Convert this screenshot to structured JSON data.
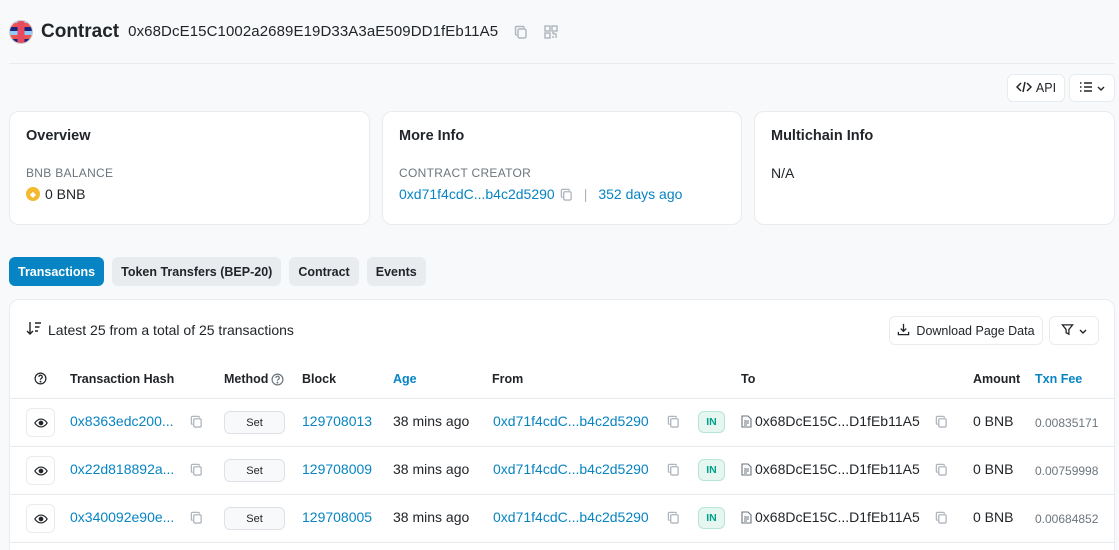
{
  "header": {
    "title": "Contract",
    "address": "0x68DcE15C1002a2689E19D33A3aE509DD1fEb11A5"
  },
  "toolbar": {
    "api_label": "API"
  },
  "overview": {
    "title": "Overview",
    "balance_label": "BNB BALANCE",
    "balance_value": "0 BNB"
  },
  "more_info": {
    "title": "More Info",
    "creator_label": "CONTRACT CREATOR",
    "creator_address": "0xd71f4cdC...b4c2d5290",
    "creator_age": "352 days ago"
  },
  "multichain": {
    "title": "Multichain Info",
    "value": "N/A"
  },
  "tabs": [
    {
      "label": "Transactions",
      "active": true
    },
    {
      "label": "Token Transfers (BEP-20)",
      "active": false
    },
    {
      "label": "Contract",
      "active": false
    },
    {
      "label": "Events",
      "active": false
    }
  ],
  "transactions": {
    "summary": "Latest 25 from a total of 25 transactions",
    "download_label": "Download Page Data",
    "columns": {
      "hash": "Transaction Hash",
      "method": "Method",
      "block": "Block",
      "age": "Age",
      "from": "From",
      "to": "To",
      "amount": "Amount",
      "fee": "Txn Fee"
    },
    "rows": [
      {
        "hash": "0x8363edc200...",
        "method": "Set",
        "block": "129708013",
        "age": "38 mins ago",
        "from": "0xd71f4cdC...b4c2d5290",
        "direction": "IN",
        "to": "0x68DcE15C...D1fEb11A5",
        "amount": "0 BNB",
        "fee": "0.00835171"
      },
      {
        "hash": "0x22d818892a...",
        "method": "Set",
        "block": "129708009",
        "age": "38 mins ago",
        "from": "0xd71f4cdC...b4c2d5290",
        "direction": "IN",
        "to": "0x68DcE15C...D1fEb11A5",
        "amount": "0 BNB",
        "fee": "0.00759998"
      },
      {
        "hash": "0x340092e90e...",
        "method": "Set",
        "block": "129708005",
        "age": "38 mins ago",
        "from": "0xd71f4cdC...b4c2d5290",
        "direction": "IN",
        "to": "0x68DcE15C...D1fEb11A5",
        "amount": "0 BNB",
        "fee": "0.00684852"
      }
    ]
  },
  "colors": {
    "accent": "#0784c3",
    "in_badge": "#00a186",
    "bnb": "#f3ba2f"
  }
}
